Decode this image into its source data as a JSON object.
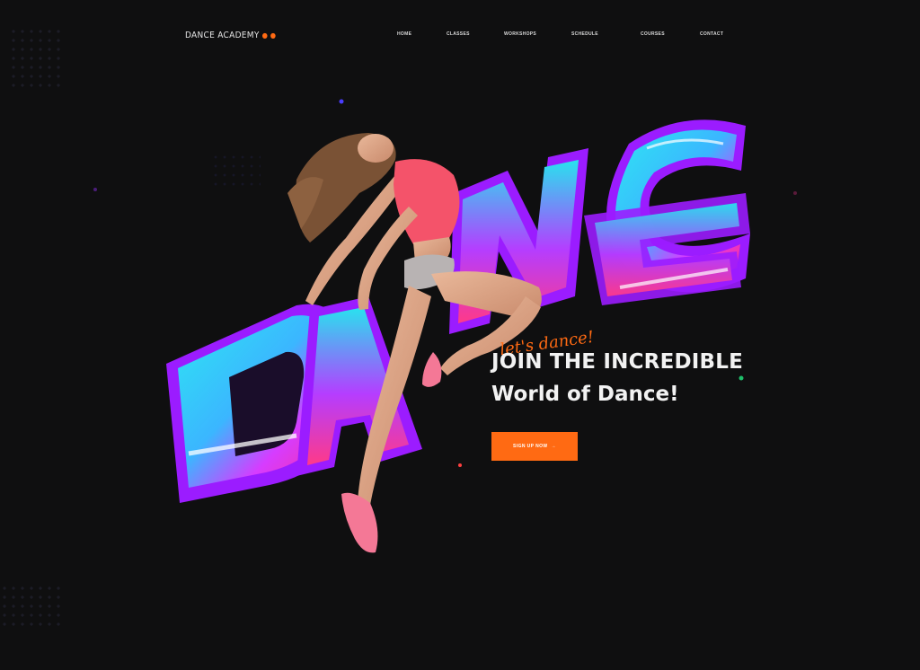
{
  "nav": {
    "logo": "DANCE ACADEMY",
    "logo_accent": "● ●",
    "items": [
      {
        "label": "HOME"
      },
      {
        "label": "CLASSES"
      },
      {
        "label": "WORKSHOPS"
      },
      {
        "label": "SCHEDULE"
      },
      {
        "label": "COURSES"
      },
      {
        "label": "CONTACT"
      }
    ]
  },
  "hero": {
    "graffiti_word": "DANCE",
    "tagline": "let's dance!",
    "heading_line1": "JOIN THE INCREDIBLE",
    "heading_line2": "World of Dance!",
    "cta_label": "SIGN UP NOW",
    "cta_arrow": "→"
  },
  "colors": {
    "background": "#0f0f10",
    "accent": "#ff6a13",
    "graffiti_outline": "#9b1cff",
    "graffiti_cyan": "#27e0f0",
    "graffiti_magenta": "#ff2fbf"
  }
}
